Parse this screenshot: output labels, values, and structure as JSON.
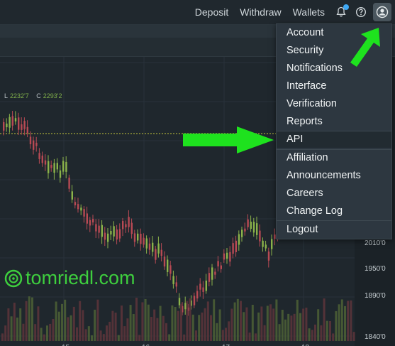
{
  "topnav": {
    "deposit": "Deposit",
    "withdraw": "Withdraw",
    "wallets": "Wallets"
  },
  "icons": {
    "bell": "bell-icon",
    "help": "help-icon",
    "user": "user-icon"
  },
  "menu": {
    "items": [
      {
        "label": "Account"
      },
      {
        "label": "Security"
      },
      {
        "label": "Notifications"
      },
      {
        "label": "Interface"
      },
      {
        "label": "Verification"
      },
      {
        "label": "Reports"
      },
      {
        "label": "API",
        "highlighted": true
      },
      {
        "label": "Affiliation"
      },
      {
        "label": "Announcements"
      },
      {
        "label": "Careers"
      },
      {
        "label": "Change Log"
      },
      {
        "label": "Logout"
      }
    ]
  },
  "ohlc": {
    "l_label": "L",
    "l_value": "2232'7",
    "c_label": "C",
    "c_value": "2293'2"
  },
  "price_axis": [
    "2010'0",
    "1950'0",
    "1890'0",
    "1840'0"
  ],
  "date_axis": [
    "15",
    "16",
    "17",
    "18"
  ],
  "watermark": "tomriedl.com",
  "colors": {
    "up": "#8bb34a",
    "down": "#b84a54",
    "accent": "#3fa9f5",
    "annotation_arrow": "#1ee21e",
    "menu_bg": "#2d3740"
  }
}
